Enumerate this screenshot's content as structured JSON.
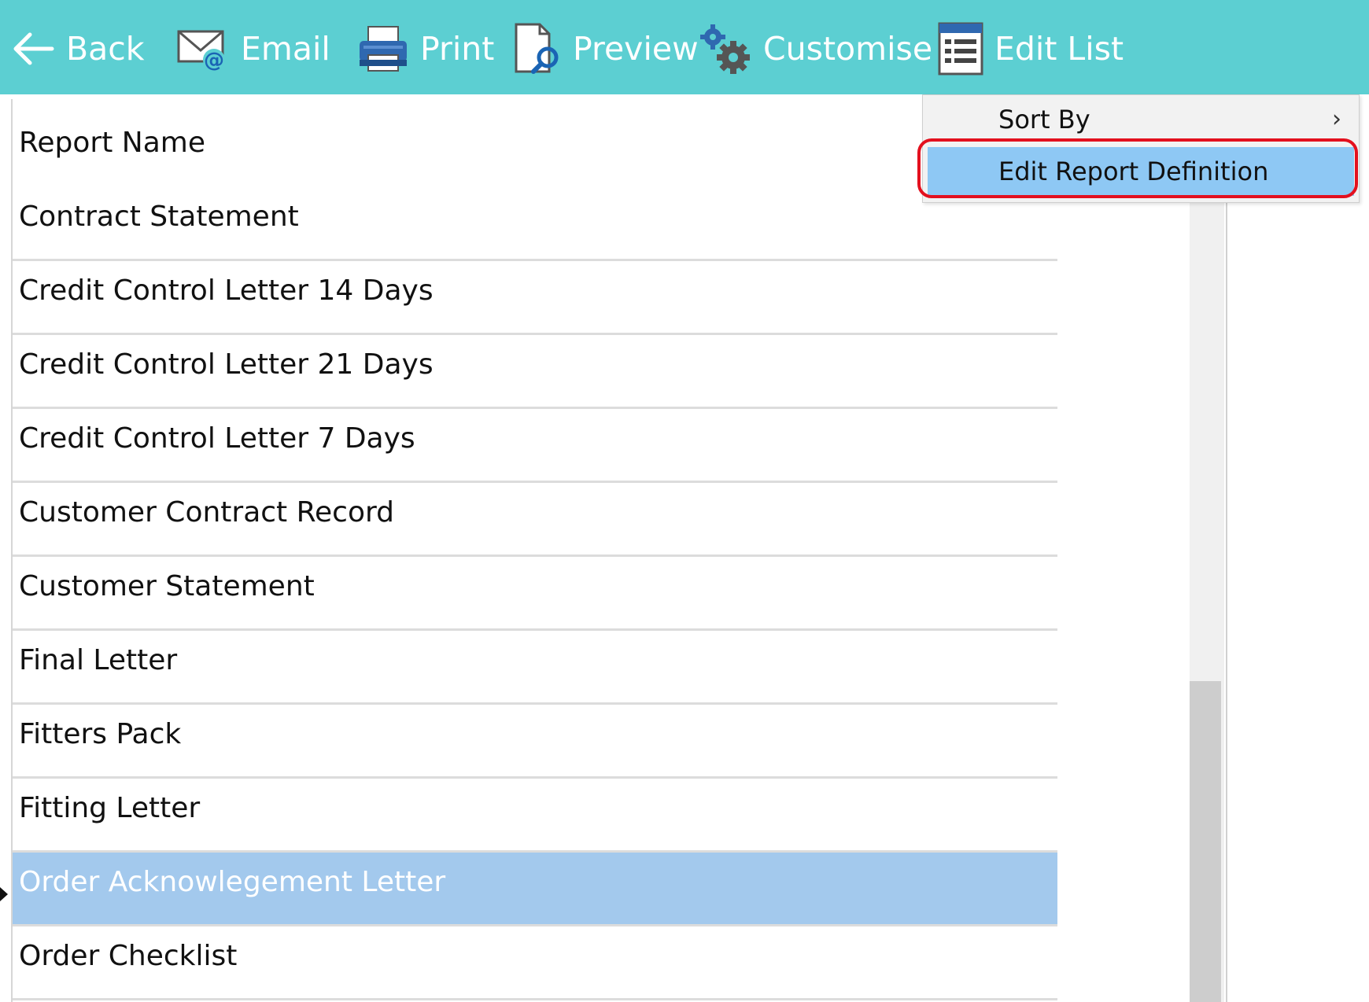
{
  "toolbar": {
    "buttons": [
      {
        "label": "Back",
        "icon": "back-arrow-icon"
      },
      {
        "label": "Email",
        "icon": "email-icon"
      },
      {
        "label": "Print",
        "icon": "printer-icon"
      },
      {
        "label": "Preview",
        "icon": "preview-icon"
      },
      {
        "label": "Customise",
        "icon": "gears-icon"
      },
      {
        "label": "Edit List",
        "icon": "list-icon"
      }
    ]
  },
  "list": {
    "header": "Report Name",
    "rows": [
      "Contract Statement",
      "Credit Control Letter 14 Days",
      "Credit Control Letter 21 Days",
      "Credit Control Letter 7 Days",
      "Customer Contract Record",
      "Customer Statement",
      "Final Letter",
      "Fitters Pack",
      "Fitting Letter",
      "Order Acknowlegement Letter",
      "Order Checklist"
    ],
    "selected_row": "Order Acknowlegement Letter"
  },
  "context_menu": {
    "items": [
      {
        "label": "Sort By",
        "submenu_glyph": "›"
      },
      {
        "label": "Edit Report Definition"
      }
    ]
  },
  "colors": {
    "toolbar_bg": "#5ccfd2",
    "selected_row_bg": "#a3c9ed",
    "menu_hover_bg": "#8ec8f4",
    "highlight_ring": "#e3101e"
  }
}
